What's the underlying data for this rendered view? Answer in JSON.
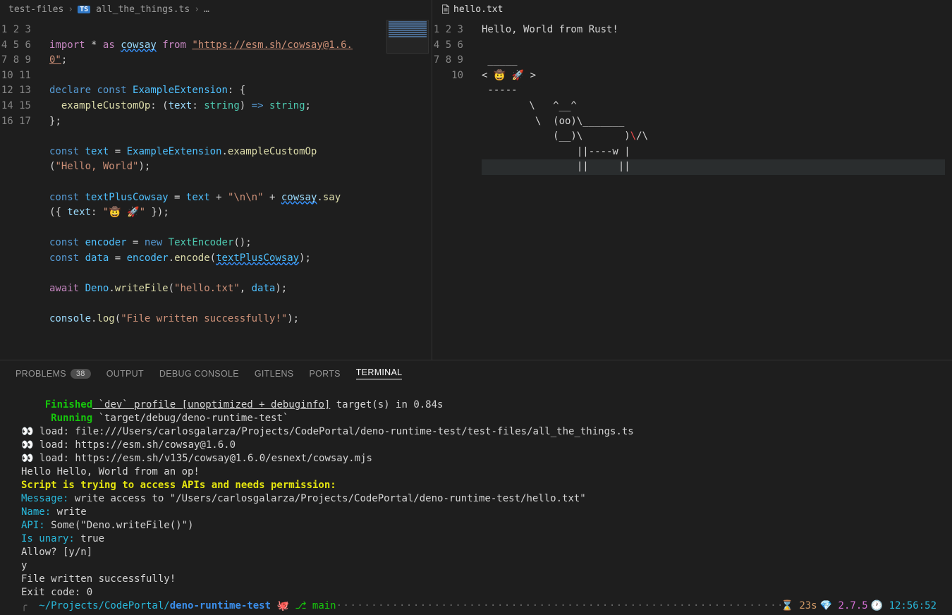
{
  "breadcrumb_left": {
    "folder": "test-files",
    "file": "all_the_things.ts",
    "file_badge": "TS",
    "ellipsis": "…"
  },
  "breadcrumb_right": {
    "file": "hello.txt"
  },
  "left_gutter_max": 17,
  "code_left": {
    "line1": {
      "import": "import",
      "star": "*",
      "as": "as",
      "cowsay": "cowsay",
      "from": "from",
      "url_a": "\"https://esm.sh/cowsay@1.6.",
      "url_b": "0\"",
      "semi": ";"
    },
    "line3": {
      "declare": "declare",
      "const": "const",
      "name": "ExampleExtension",
      "colon": ":",
      "brace": "{"
    },
    "line4": {
      "prop": "exampleCustomOp",
      "colon": ":",
      "open": "(",
      "param": "text",
      "tcol": ":",
      "type": "string",
      "close": ")",
      "arrow": "=>",
      "rtype": "string",
      "semi": ";"
    },
    "line5": {
      "brace": "}",
      "semi": ";"
    },
    "line7a": {
      "const": "const",
      "name": "text",
      "eq": "=",
      "obj": "ExampleExtension",
      "dot": ".",
      "fn": "exampleCustomOp"
    },
    "line7b": {
      "open": "(",
      "str": "\"Hello, World\"",
      "close": ")",
      "semi": ";"
    },
    "line9": {
      "const": "const",
      "name": "textPlusCowsay",
      "eq": "=",
      "a": "text",
      "plus": "+",
      "s1": "\"\\n\\n\"",
      "plus2": "+",
      "obj": "cowsay",
      "dot": ".",
      "fn": "say"
    },
    "line9b": {
      "open": "(",
      "brace": "{ ",
      "key": "text",
      "col": ":",
      "val": "\"🤠 🚀\"",
      "braceC": " }",
      "close": ")",
      "semi": ";"
    },
    "line11": {
      "const": "const",
      "name": "encoder",
      "eq": "=",
      "new": "new",
      "cls": "TextEncoder",
      "parens": "()",
      "semi": ";"
    },
    "line12": {
      "const": "const",
      "name": "data",
      "eq": "=",
      "obj": "encoder",
      "dot": ".",
      "fn": "encode",
      "open": "(",
      "arg": "textPlusCowsay",
      "close": ")",
      "semi": ";"
    },
    "line14": {
      "await": "await",
      "obj": "Deno",
      "dot": ".",
      "fn": "writeFile",
      "open": "(",
      "s": "\"hello.txt\"",
      "comma": ", ",
      "arg": "data",
      "close": ")",
      "semi": ";"
    },
    "line16": {
      "obj": "console",
      "dot": ".",
      "fn": "log",
      "open": "(",
      "s": "\"File written successfully!\"",
      "close": ")",
      "semi": ";"
    }
  },
  "right_gutter_max": 10,
  "code_right": [
    "Hello, World from Rust!",
    "",
    " _____",
    "< 🤠 🚀 >",
    " -----",
    "        \\   ^__^",
    "         \\  (oo)\\_______",
    "            (__)\\       )\\/\\",
    "                ||----w |",
    "                ||     ||"
  ],
  "code_right_red_cols": {
    "line8_start": 25,
    "line8_len": 1
  },
  "panel_tabs": {
    "problems": "PROBLEMS",
    "problems_count": "38",
    "output": "OUTPUT",
    "debug": "DEBUG CONSOLE",
    "gitlens": "GITLENS",
    "ports": "PORTS",
    "terminal": "TERMINAL"
  },
  "terminal": {
    "l1": {
      "indent": "    ",
      "finished": "Finished",
      "rest": " `dev` profile [unoptimized + debuginfo]",
      "rest2": " target(s) in 0.84s"
    },
    "l2": {
      "indent": "     ",
      "running": "Running",
      "rest": " `target/debug/deno-runtime-test`"
    },
    "l3": "👀 load: file:///Users/carlosgalarza/Projects/CodePortal/deno-runtime-test/test-files/all_the_things.ts",
    "l4": "👀 load: https://esm.sh/cowsay@1.6.0",
    "l5": "👀 load: https://esm.sh/v135/cowsay@1.6.0/esnext/cowsay.mjs",
    "l6": "Hello Hello, World from an op!",
    "l7": "Script is trying to access APIs and needs permission:",
    "l8a": "Message:",
    "l8b": " write access to \"/Users/carlosgalarza/Projects/CodePortal/deno-runtime-test/hello.txt\"",
    "l9a": "Name:",
    "l9b": " write",
    "l10a": "API:",
    "l10b": " Some(\"Deno.writeFile()\")",
    "l11a": "Is unary:",
    "l11b": " true",
    "l12": "Allow? [y/n]",
    "l13": "y",
    "l14": "File written successfully!",
    "l15": "Exit code: 0",
    "prompt": {
      "apple": "",
      "tilde": " ~/Projects/CodePortal/",
      "project": "deno-runtime-test",
      "git_icon": " ",
      "branch": "main",
      "time_icon": "⌛ ",
      "time": "23s",
      "ruby_icon": "💎 ",
      "ruby": "2.7.5",
      "clock_icon": "🕐 ",
      "clock": "12:56:52"
    }
  }
}
